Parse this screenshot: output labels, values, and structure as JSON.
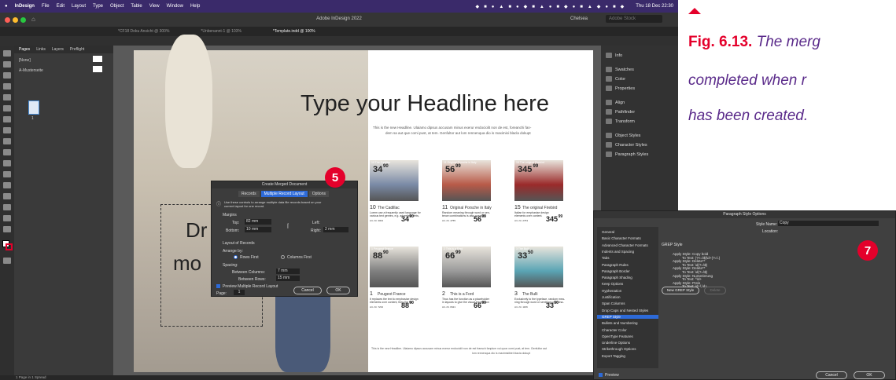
{
  "menubar": {
    "items": [
      "InDesign",
      "File",
      "Edit",
      "Layout",
      "Type",
      "Object",
      "Table",
      "View",
      "Window",
      "Help"
    ],
    "datetime": "Thu 18 Dec 22:30"
  },
  "window": {
    "title": "Adobe InDesign 2022",
    "tabs": [
      "*CF18 Doku Ansicht @ 300%",
      "*Unbenannt-1 @ 103%",
      "*Template.indd @ 100%"
    ],
    "workspace": "Chelsea",
    "search_placeholder": "Adobe Stock"
  },
  "pages_panel": {
    "tabs": [
      "Pages",
      "Links",
      "Layers",
      "Preflight"
    ],
    "none_label": "[None]",
    "master_label": "A-Musterseite",
    "page_number": "1",
    "footer": "1 Page in 1 Spread"
  },
  "right_panel": {
    "items": [
      "Info",
      "Swatches",
      "Color",
      "Properties",
      "Align",
      "Pathfinder",
      "Transform",
      "Object Styles",
      "Character Styles",
      "Paragraph Styles"
    ]
  },
  "spread": {
    "headline": "Type your Headline here",
    "intro_1": "This is the new Headline. Ulaiamo dipsus accusam minus exerur endociolit non de est, foreanchi fan-",
    "intro_2": "dem sa aut que comi pust, at tem. Genfultor aut lom rennenqua dio is maximisi blacla dokupt",
    "big_text_1": "Dr",
    "big_text_2": "mo",
    "footer_1": "This is the new Headline. Ulaiamo dipsus accusam minus exerur endociolit non de est fransch fanplum vui quon comi pust, at tem. Genfultor aut",
    "footer_2": "lom rennenqua dio is maximisiblei blacla dokupt",
    "cards": [
      {
        "num": "10",
        "tag": "10 The Cadillac",
        "price_main": "34",
        "price_sup": "90",
        "name": "The Cadillac",
        "p1": "Lorem use a frequently used language for",
        "p2": "various text genres, e.g. advertisements,",
        "sku": "Art.-Nr. 3004",
        "small_price": "34",
        "small_sup": "90",
        "color": "#7a8aa6"
      },
      {
        "num": "11",
        "tag": "11 Original Porsche in Italy",
        "price_main": "56",
        "price_sup": "99",
        "name": "Original Porsche in Italy",
        "p1": "Random meaning through word or sen-",
        "p2": "tence combinations is also possible.",
        "sku": "Art.-Nr. 4755",
        "small_price": "56",
        "small_sup": "99",
        "color": "#b85a48"
      },
      {
        "num": "15",
        "tag": "15 The original Firebird",
        "price_main": "345",
        "price_sup": "99",
        "name": "The original Firebird",
        "p1": "Italian for emphasise design",
        "p2": "elements over content.",
        "sku": "Art.-Nr. 2763",
        "small_price": "345",
        "small_sup": "99",
        "color": "#9a2a2a"
      },
      {
        "num": "1",
        "tag": "1 Peugeot France",
        "price_main": "88",
        "price_sup": "90",
        "name": "Peugeot France",
        "p1": "It replaces the text to emphasise design",
        "p2": "elements over content, then the the",
        "sku": "Art.-Nr. 7234",
        "small_price": "88",
        "small_sup": "90",
        "color": "#808080"
      },
      {
        "num": "2",
        "tag": "2 This is a Ford",
        "price_main": "66",
        "price_sup": "99",
        "name": "This is a Ford",
        "p1": "Thus has the function as a placeholder",
        "p2": "in layouts to give the visual impression",
        "sku": "Art.-Nr. 8421",
        "small_price": "66",
        "small_sup": "99",
        "color": "#9a9a9a"
      },
      {
        "num": "3",
        "tag": "3 The Bulli",
        "price_main": "33",
        "price_sup": "50",
        "name": "The Bulli",
        "p1": "Exclusively to the typeface, random mea-",
        "p2": "ning through word or sentence combina-",
        "sku": "Art.-Nr. 1166",
        "small_price": "33",
        "small_sup": "50",
        "color": "#5aa4b4"
      }
    ]
  },
  "merge_dialog": {
    "title": "Create Merged Document",
    "tabs": [
      "Records",
      "Multiple Record Layout",
      "Options"
    ],
    "info": "Use these controls to arrange multiple data file records based on your current layout for one record.",
    "margins_label": "Margins",
    "top_label": "Top:",
    "top_value": "82 mm",
    "bottom_label": "Bottom:",
    "bottom_value": "10 mm",
    "left_label": "Left:",
    "right_label": "Right:",
    "right_value": "2 mm",
    "layout_label": "Layout of Records",
    "arrange_label": "Arrange by:",
    "rows_first": "Rows First",
    "columns_first": "Columns First",
    "spacing_label": "Spacing:",
    "between_columns_label": "Between Columns:",
    "between_columns_value": "7 mm",
    "between_rows_label": "Between Rows:",
    "between_rows_value": "15 mm",
    "preview_label": "Preview Multiple Record Layout",
    "page_label": "Page:",
    "page_value": "1",
    "cancel": "Cancel",
    "ok": "OK",
    "badge": "5"
  },
  "para_dialog": {
    "title": "Paragraph Style Options",
    "style_name_label": "Style Name:",
    "style_name_value": "Copy",
    "location_label": "Location:",
    "list": [
      "General",
      "Basic Character Formats",
      "Advanced Character Formats",
      "Indents and Spacing",
      "Tabs",
      "Paragraph Rules",
      "Paragraph Border",
      "Paragraph Shading",
      "Keep Options",
      "Hyphenation",
      "Justification",
      "Span Columns",
      "Drop Caps and Nested Styles",
      "GREP Style",
      "Bullets and Numbering",
      "Character Color",
      "OpenType Features",
      "Underline Options",
      "Strikethrough Options",
      "Export Tagging"
    ],
    "selected_index": 13,
    "section_title": "GREP Style",
    "rules": [
      {
        "apply": "Apply Style: Copy bold",
        "text": "To Text: (?<=\\$)\\d+(?=\\.)"
      },
      {
        "apply": "Apply Style: Delete**",
        "text": "To Text: \\d(?=\\$)"
      },
      {
        "apply": "Apply Style: Delete**",
        "text": "To Text: \\d(?=\\$)"
      },
      {
        "apply": "Apply Style: Numerierung",
        "text": "To Text: ^\\d+"
      },
      {
        "apply": "Apply Style: Preis",
        "text": "To Text: \\d+\\,\\d+"
      }
    ],
    "new_button": "New GREP Style",
    "delete_button": "Delete",
    "preview_label": "Preview",
    "cancel": "Cancel",
    "ok": "OK",
    "badge": "7"
  },
  "caption": {
    "fig": "Fig. 6.13.",
    "line1": "The merg",
    "line2": "completed when r",
    "line3": "has been created."
  },
  "colors": {
    "accent_red": "#e4002b",
    "menubar": "#3a2a6a",
    "selection_blue": "#2d6ad8"
  }
}
